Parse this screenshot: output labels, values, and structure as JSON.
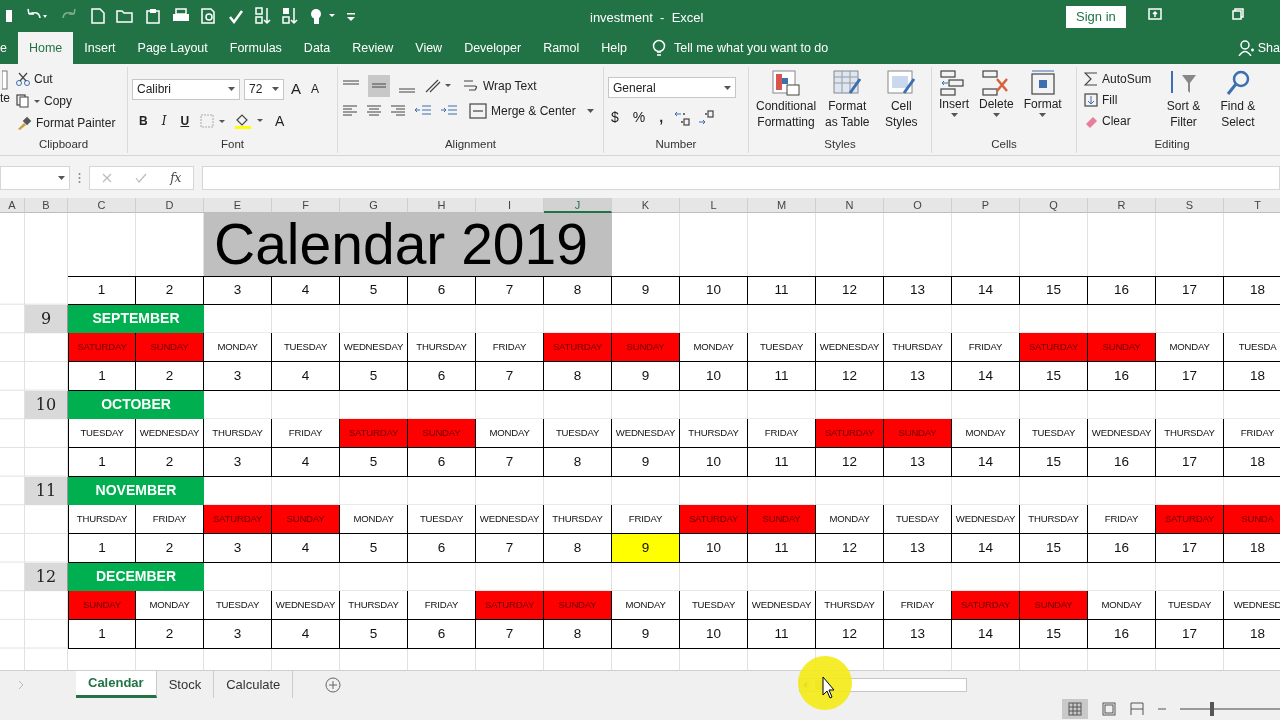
{
  "title": "investment  -  Excel",
  "sign_in": "Sign in",
  "ribbon_tabs": [
    {
      "label": "e",
      "selected": false
    },
    {
      "label": "Home",
      "selected": true
    },
    {
      "label": "Insert",
      "selected": false
    },
    {
      "label": "Page Layout",
      "selected": false
    },
    {
      "label": "Formulas",
      "selected": false
    },
    {
      "label": "Data",
      "selected": false
    },
    {
      "label": "Review",
      "selected": false
    },
    {
      "label": "View",
      "selected": false
    },
    {
      "label": "Developer",
      "selected": false
    },
    {
      "label": "Ramol",
      "selected": false
    },
    {
      "label": "Help",
      "selected": false
    }
  ],
  "tell_me": "Tell me what you want to do",
  "share": "Sha",
  "clipboard": {
    "paste": "te",
    "cut": "Cut",
    "copy": "Copy",
    "format_painter": "Format Painter",
    "label": "Clipboard"
  },
  "font": {
    "name": "Calibri",
    "size": "72",
    "grow": "A",
    "shrink": "A",
    "bold": "B",
    "italic": "I",
    "underline": "U",
    "font_color": "A",
    "label": "Font"
  },
  "alignment": {
    "wrap_text": "Wrap Text",
    "merge_center": "Merge & Center",
    "label": "Alignment"
  },
  "number": {
    "format": "General",
    "currency": "$",
    "percent": "%",
    "comma": ",",
    "label": "Number"
  },
  "styles": {
    "buttons": [
      "Conditional Formatting",
      "Format as Table",
      "Cell Styles"
    ],
    "label": "Styles"
  },
  "cells": {
    "buttons": [
      "Insert",
      "Delete",
      "Format"
    ],
    "label": "Cells"
  },
  "editing": {
    "autosum": "AutoSum",
    "fill": "Fill",
    "clear": "Clear",
    "buttons": [
      "Sort & Filter",
      "Find & Select"
    ],
    "label": "Editing"
  },
  "formula_bar": {
    "fx": "fx"
  },
  "columns": [
    {
      "label": "A",
      "selected": false
    },
    {
      "label": "B",
      "selected": false
    },
    {
      "label": "C",
      "selected": false
    },
    {
      "label": "D",
      "selected": false
    },
    {
      "label": "E",
      "selected": false
    },
    {
      "label": "F",
      "selected": false
    },
    {
      "label": "G",
      "selected": false
    },
    {
      "label": "H",
      "selected": false
    },
    {
      "label": "I",
      "selected": false
    },
    {
      "label": "J",
      "selected": true
    },
    {
      "label": "K",
      "selected": false
    },
    {
      "label": "L",
      "selected": false
    },
    {
      "label": "M",
      "selected": false
    },
    {
      "label": "N",
      "selected": false
    },
    {
      "label": "O",
      "selected": false
    },
    {
      "label": "P",
      "selected": false
    },
    {
      "label": "Q",
      "selected": false
    },
    {
      "label": "R",
      "selected": false
    },
    {
      "label": "S",
      "selected": false
    },
    {
      "label": "T",
      "selected": false
    }
  ],
  "sheet": {
    "title": "Calendar 2019",
    "numbers": [
      "1",
      "2",
      "3",
      "4",
      "5",
      "6",
      "7",
      "8",
      "9",
      "10",
      "11",
      "12",
      "13",
      "14",
      "15",
      "16",
      "17",
      "18"
    ],
    "months": [
      {
        "number": "9",
        "name": "SEPTEMBER",
        "days": [
          {
            "label": "SATURDAY",
            "weekend": true
          },
          {
            "label": "SUNDAY",
            "weekend": true
          },
          {
            "label": "MONDAY",
            "weekend": false
          },
          {
            "label": "TUESDAY",
            "weekend": false
          },
          {
            "label": "WEDNESDAY",
            "weekend": false
          },
          {
            "label": "THURSDAY",
            "weekend": false
          },
          {
            "label": "FRIDAY",
            "weekend": false
          },
          {
            "label": "SATURDAY",
            "weekend": true
          },
          {
            "label": "SUNDAY",
            "weekend": true
          },
          {
            "label": "MONDAY",
            "weekend": false
          },
          {
            "label": "TUESDAY",
            "weekend": false
          },
          {
            "label": "WEDNESDAY",
            "weekend": false
          },
          {
            "label": "THURSDAY",
            "weekend": false
          },
          {
            "label": "FRIDAY",
            "weekend": false
          },
          {
            "label": "SATURDAY",
            "weekend": true
          },
          {
            "label": "SUNDAY",
            "weekend": true
          },
          {
            "label": "MONDAY",
            "weekend": false
          },
          {
            "label": "TUESDA",
            "weekend": false
          }
        ],
        "dates": [
          {
            "label": "1",
            "highlighted": false
          },
          {
            "label": "2",
            "highlighted": false
          },
          {
            "label": "3",
            "highlighted": false
          },
          {
            "label": "4",
            "highlighted": false
          },
          {
            "label": "5",
            "highlighted": false
          },
          {
            "label": "6",
            "highlighted": false
          },
          {
            "label": "7",
            "highlighted": false
          },
          {
            "label": "8",
            "highlighted": false
          },
          {
            "label": "9",
            "highlighted": false
          },
          {
            "label": "10",
            "highlighted": false
          },
          {
            "label": "11",
            "highlighted": false
          },
          {
            "label": "12",
            "highlighted": false
          },
          {
            "label": "13",
            "highlighted": false
          },
          {
            "label": "14",
            "highlighted": false
          },
          {
            "label": "15",
            "highlighted": false
          },
          {
            "label": "16",
            "highlighted": false
          },
          {
            "label": "17",
            "highlighted": false
          },
          {
            "label": "18",
            "highlighted": false
          }
        ]
      },
      {
        "number": "10",
        "name": "OCTOBER",
        "days": [
          {
            "label": "TUESDAY",
            "weekend": false
          },
          {
            "label": "WEDNESDAY",
            "weekend": false
          },
          {
            "label": "THURSDAY",
            "weekend": false
          },
          {
            "label": "FRIDAY",
            "weekend": false
          },
          {
            "label": "SATURDAY",
            "weekend": true
          },
          {
            "label": "SUNDAY",
            "weekend": true
          },
          {
            "label": "MONDAY",
            "weekend": false
          },
          {
            "label": "TUESDAY",
            "weekend": false
          },
          {
            "label": "WEDNESDAY",
            "weekend": false
          },
          {
            "label": "THURSDAY",
            "weekend": false
          },
          {
            "label": "FRIDAY",
            "weekend": false
          },
          {
            "label": "SATURDAY",
            "weekend": true
          },
          {
            "label": "SUNDAY",
            "weekend": true
          },
          {
            "label": "MONDAY",
            "weekend": false
          },
          {
            "label": "TUESDAY",
            "weekend": false
          },
          {
            "label": "WEDNESDAY",
            "weekend": false
          },
          {
            "label": "THURSDAY",
            "weekend": false
          },
          {
            "label": "FRIDAY",
            "weekend": false
          }
        ],
        "dates": [
          {
            "label": "1",
            "highlighted": false
          },
          {
            "label": "2",
            "highlighted": false
          },
          {
            "label": "3",
            "highlighted": false
          },
          {
            "label": "4",
            "highlighted": false
          },
          {
            "label": "5",
            "highlighted": false
          },
          {
            "label": "6",
            "highlighted": false
          },
          {
            "label": "7",
            "highlighted": false
          },
          {
            "label": "8",
            "highlighted": false
          },
          {
            "label": "9",
            "highlighted": false
          },
          {
            "label": "10",
            "highlighted": false
          },
          {
            "label": "11",
            "highlighted": false
          },
          {
            "label": "12",
            "highlighted": false
          },
          {
            "label": "13",
            "highlighted": false
          },
          {
            "label": "14",
            "highlighted": false
          },
          {
            "label": "15",
            "highlighted": false
          },
          {
            "label": "16",
            "highlighted": false
          },
          {
            "label": "17",
            "highlighted": false
          },
          {
            "label": "18",
            "highlighted": false
          }
        ]
      },
      {
        "number": "11",
        "name": "NOVEMBER",
        "days": [
          {
            "label": "THURSDAY",
            "weekend": false
          },
          {
            "label": "FRIDAY",
            "weekend": false
          },
          {
            "label": "SATURDAY",
            "weekend": true
          },
          {
            "label": "SUNDAY",
            "weekend": true
          },
          {
            "label": "MONDAY",
            "weekend": false
          },
          {
            "label": "TUESDAY",
            "weekend": false
          },
          {
            "label": "WEDNESDAY",
            "weekend": false
          },
          {
            "label": "THURSDAY",
            "weekend": false
          },
          {
            "label": "FRIDAY",
            "weekend": false
          },
          {
            "label": "SATURDAY",
            "weekend": true
          },
          {
            "label": "SUNDAY",
            "weekend": true
          },
          {
            "label": "MONDAY",
            "weekend": false
          },
          {
            "label": "TUESDAY",
            "weekend": false
          },
          {
            "label": "WEDNESDAY",
            "weekend": false
          },
          {
            "label": "THURSDAY",
            "weekend": false
          },
          {
            "label": "FRIDAY",
            "weekend": false
          },
          {
            "label": "SATURDAY",
            "weekend": true
          },
          {
            "label": "SUNDA",
            "weekend": true
          }
        ],
        "dates": [
          {
            "label": "1",
            "highlighted": false
          },
          {
            "label": "2",
            "highlighted": false
          },
          {
            "label": "3",
            "highlighted": false
          },
          {
            "label": "4",
            "highlighted": false
          },
          {
            "label": "5",
            "highlighted": false
          },
          {
            "label": "6",
            "highlighted": false
          },
          {
            "label": "7",
            "highlighted": false
          },
          {
            "label": "8",
            "highlighted": false
          },
          {
            "label": "9",
            "highlighted": true
          },
          {
            "label": "10",
            "highlighted": false
          },
          {
            "label": "11",
            "highlighted": false
          },
          {
            "label": "12",
            "highlighted": false
          },
          {
            "label": "13",
            "highlighted": false
          },
          {
            "label": "14",
            "highlighted": false
          },
          {
            "label": "15",
            "highlighted": false
          },
          {
            "label": "16",
            "highlighted": false
          },
          {
            "label": "17",
            "highlighted": false
          },
          {
            "label": "18",
            "highlighted": false
          }
        ]
      },
      {
        "number": "12",
        "name": "DECEMBER",
        "days": [
          {
            "label": "SUNDAY",
            "weekend": true
          },
          {
            "label": "MONDAY",
            "weekend": false
          },
          {
            "label": "TUESDAY",
            "weekend": false
          },
          {
            "label": "WEDNESDAY",
            "weekend": false
          },
          {
            "label": "THURSDAY",
            "weekend": false
          },
          {
            "label": "FRIDAY",
            "weekend": false
          },
          {
            "label": "SATURDAY",
            "weekend": true
          },
          {
            "label": "SUNDAY",
            "weekend": true
          },
          {
            "label": "MONDAY",
            "weekend": false
          },
          {
            "label": "TUESDAY",
            "weekend": false
          },
          {
            "label": "WEDNESDAY",
            "weekend": false
          },
          {
            "label": "THURSDAY",
            "weekend": false
          },
          {
            "label": "FRIDAY",
            "weekend": false
          },
          {
            "label": "SATURDAY",
            "weekend": true
          },
          {
            "label": "SUNDAY",
            "weekend": true
          },
          {
            "label": "MONDAY",
            "weekend": false
          },
          {
            "label": "TUESDAY",
            "weekend": false
          },
          {
            "label": "WEDNESD",
            "weekend": false
          }
        ],
        "dates": [
          {
            "label": "1",
            "highlighted": false
          },
          {
            "label": "2",
            "highlighted": false
          },
          {
            "label": "3",
            "highlighted": false
          },
          {
            "label": "4",
            "highlighted": false
          },
          {
            "label": "5",
            "highlighted": false
          },
          {
            "label": "6",
            "highlighted": false
          },
          {
            "label": "7",
            "highlighted": false
          },
          {
            "label": "8",
            "highlighted": false
          },
          {
            "label": "9",
            "highlighted": false
          },
          {
            "label": "10",
            "highlighted": false
          },
          {
            "label": "11",
            "highlighted": false
          },
          {
            "label": "12",
            "highlighted": false
          },
          {
            "label": "13",
            "highlighted": false
          },
          {
            "label": "14",
            "highlighted": false
          },
          {
            "label": "15",
            "highlighted": false
          },
          {
            "label": "16",
            "highlighted": false
          },
          {
            "label": "17",
            "highlighted": false
          },
          {
            "label": "18",
            "highlighted": false
          }
        ]
      }
    ]
  },
  "sheet_tabs": [
    {
      "label": "Calendar",
      "selected": true
    },
    {
      "label": "Stock",
      "selected": false
    },
    {
      "label": "Calculate",
      "selected": false
    }
  ],
  "zoom": {
    "level": 0.3
  }
}
